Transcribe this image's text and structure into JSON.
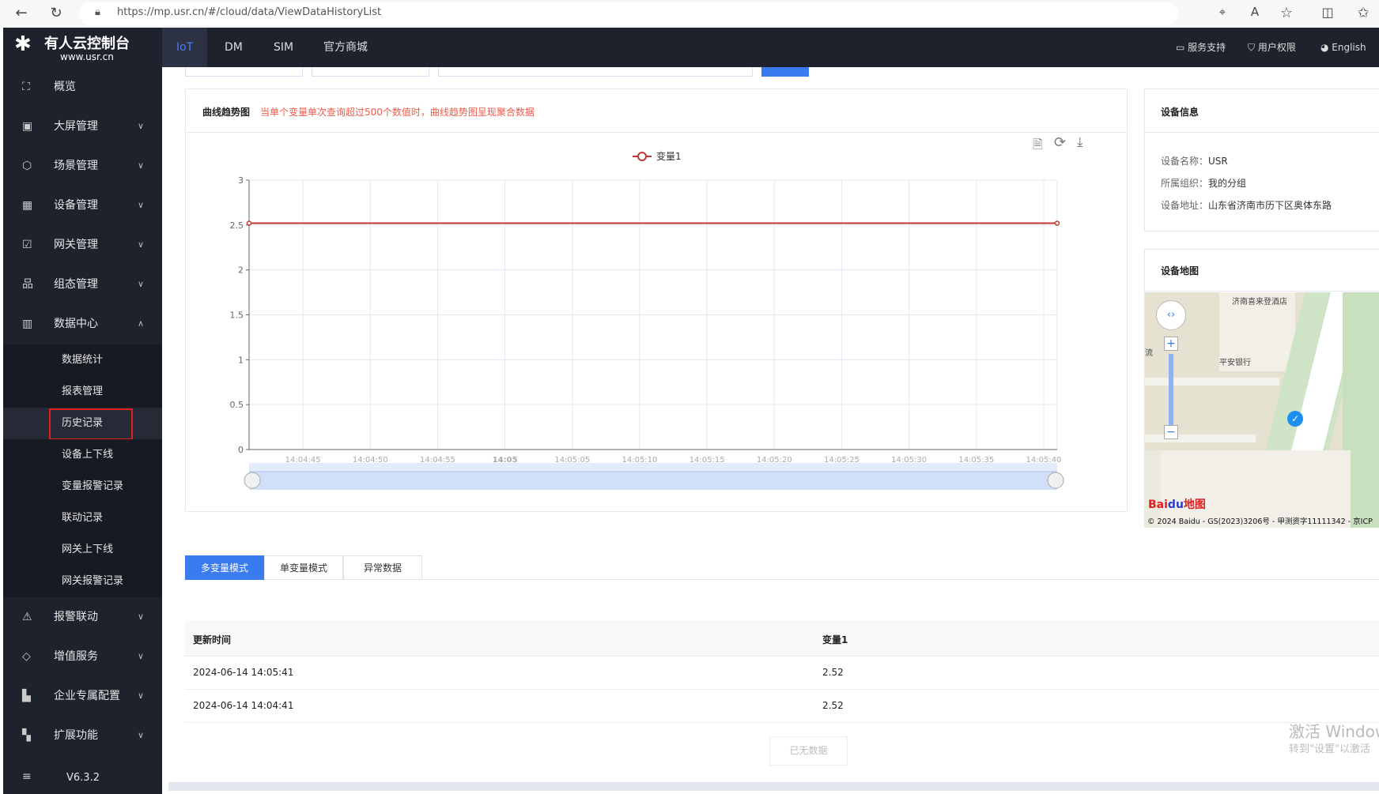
{
  "browser": {
    "url": "https://mp.usr.cn/#/cloud/data/ViewDataHistoryList",
    "icons": [
      "back-icon",
      "refresh-icon",
      "lock-icon",
      "location-icon",
      "read-aloud-icon",
      "favorite-icon",
      "split-screen-icon",
      "favorites-list-icon"
    ]
  },
  "brand": {
    "title": "有人云控制台",
    "subtitle": "www.usr.cn"
  },
  "nav": {
    "tabs": [
      "IoT",
      "DM",
      "SIM",
      "官方商城"
    ],
    "active": "IoT",
    "right": [
      {
        "label": "服务支持",
        "icon": "chat-icon"
      },
      {
        "label": "用户权限",
        "icon": "shield-icon"
      },
      {
        "label": "English",
        "icon": "globe-icon"
      }
    ]
  },
  "sidebar": {
    "items": [
      {
        "label": "概览",
        "icon": "scan-icon"
      },
      {
        "label": "大屏管理",
        "icon": "monitor-icon"
      },
      {
        "label": "场景管理",
        "icon": "cube-icon"
      },
      {
        "label": "设备管理",
        "icon": "device-grid-icon"
      },
      {
        "label": "网关管理",
        "icon": "chart-box-icon"
      },
      {
        "label": "组态管理",
        "icon": "hierarchy-icon"
      },
      {
        "label": "数据中心",
        "icon": "bar-chart-icon"
      }
    ],
    "sub_items": [
      "数据统计",
      "报表管理",
      "历史记录",
      "设备上下线",
      "变量报警记录",
      "联动记录",
      "网关上下线",
      "网关报警记录"
    ],
    "selected_sub": "历史记录",
    "items_after": [
      {
        "label": "报警联动",
        "icon": "alarm-icon"
      },
      {
        "label": "增值服务",
        "icon": "diamond-icon"
      },
      {
        "label": "企业专属配置",
        "icon": "building-icon"
      },
      {
        "label": "扩展功能",
        "icon": "apps-icon"
      }
    ],
    "version": "V6.3.2"
  },
  "chart_panel": {
    "title": "曲线趋势图",
    "notice": "当单个变量单次查询超过500个数值时，曲线趋势图呈现聚合数据",
    "toolbox": [
      "data-view-icon",
      "restore-icon",
      "save-image-icon"
    ]
  },
  "chart_data": {
    "type": "line",
    "legend": [
      "变量1"
    ],
    "legend_position": "top-center",
    "series": [
      {
        "name": "变量1",
        "x": [
          "14:04:41",
          "14:05:41"
        ],
        "values": [
          2.52,
          2.52
        ],
        "color": "#c23531"
      }
    ],
    "x_ticks": [
      "14:04:45",
      "14:04:50",
      "14:04:55",
      "14:05",
      "14:05:05",
      "14:05:10",
      "14:05:15",
      "14:05:20",
      "14:05:25",
      "14:05:30",
      "14:05:35",
      "14:05:40"
    ],
    "y_ticks": [
      "0",
      "0.5",
      "1",
      "1.5",
      "2",
      "2.5",
      "3"
    ],
    "ylim": [
      0,
      3
    ],
    "grid": true,
    "data_zoom": [
      0,
      100
    ]
  },
  "device_info": {
    "title": "设备信息",
    "rows": [
      {
        "label": "设备名称：",
        "value": "USR"
      },
      {
        "label": "所属组织：",
        "value": "我的分组"
      },
      {
        "label": "设备地址：",
        "value": "山东省济南市历下区奥体东路"
      }
    ]
  },
  "device_map": {
    "title": "设备地图",
    "pois": [
      "济南喜来登酒店",
      "平安银行",
      "流"
    ],
    "copyright": "© 2024 Baidu - GS(2023)3206号 - 甲测资字11111342 - 京ICP",
    "logo": "Baidu地图"
  },
  "mode_tabs": [
    "多变量模式",
    "单变量模式",
    "异常数据"
  ],
  "active_mode": "多变量模式",
  "table": {
    "columns": [
      "更新时间",
      "变量1"
    ],
    "rows": [
      [
        "2024-06-14 14:05:41",
        "2.52"
      ],
      [
        "2024-06-14 14:04:41",
        "2.52"
      ]
    ]
  },
  "no_more": "已无数据",
  "watermark": {
    "line1": "激活 Windows",
    "line2": "转到\"设置\"以激活"
  }
}
